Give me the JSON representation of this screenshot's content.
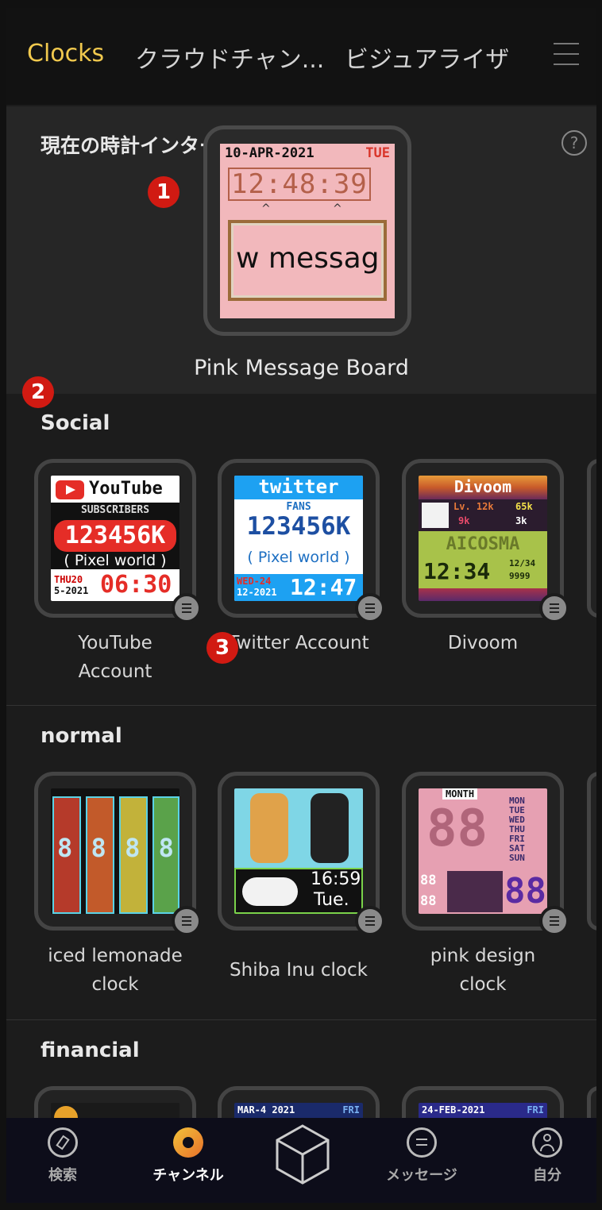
{
  "tabs": {
    "active": "Clocks",
    "cloud": "クラウドチャン...",
    "visualizer": "ビジュアライザ"
  },
  "icons": {
    "menu": "menu-icon",
    "help": "help-icon",
    "options": "list-options-icon",
    "search": "compass-icon",
    "channel": "gauge-icon",
    "cube": "cube-icon",
    "message": "chat-icon",
    "profile": "user-icon"
  },
  "current": {
    "label": "現在の時計インターフェイスです",
    "help": "?",
    "name": "Pink Message Board",
    "face": {
      "date": "10-APR-2021",
      "day": "TUE",
      "time": "12:48:39",
      "carets": "^",
      "message": "w messag"
    }
  },
  "badges": {
    "one": "1",
    "two": "2",
    "three": "3"
  },
  "sections": [
    {
      "title": "Social",
      "items": [
        {
          "name_lines": [
            "YouTube",
            "Account"
          ]
        },
        {
          "name_lines": [
            "Twitter Account"
          ]
        },
        {
          "name_lines": [
            "Divoom"
          ]
        }
      ]
    },
    {
      "title": "normal",
      "items": [
        {
          "name_lines": [
            "iced lemonade",
            "clock"
          ]
        },
        {
          "name_lines": [
            "Shiba Inu clock"
          ]
        },
        {
          "name_lines": [
            "pink design",
            "clock"
          ]
        }
      ]
    },
    {
      "title": "financial",
      "items": []
    }
  ],
  "faces": {
    "youtube": {
      "logo": "YouTube",
      "sub": "SUBSCRIBERS",
      "count": "123456K",
      "tag": "( Pixel world )",
      "date1": "THU20",
      "date2": "5-2021",
      "time": "06:30"
    },
    "twitter": {
      "logo": "twitter",
      "fans": "FANS",
      "count": "123456K",
      "tag": "( Pixel world )",
      "date1": "WED-24",
      "date2": "12-2021",
      "time": "12:47"
    },
    "divoom": {
      "logo": "Divoom",
      "lv": "Lv. 12k",
      "likes": "65k",
      "hearts": "9k",
      "other": "3k",
      "brand": "AICOSMA",
      "time": "12:34",
      "extra1": "12/34",
      "extra2": "9999"
    },
    "iced": {
      "digits": "8 8 8 8"
    },
    "shiba": {
      "time": "16:59",
      "day": "Tue."
    },
    "pink": {
      "month": "MONTH",
      "days": [
        "MON",
        "TUE",
        "WED",
        "THU",
        "FRI",
        "SAT",
        "SUN"
      ],
      "big": "88",
      "small": "88",
      "small2": "88"
    },
    "fin1": {
      "top": "MAR-4 2021",
      "day": "FRI"
    },
    "fin2": {
      "top": "24-FEB-2021",
      "day": "FRI"
    }
  },
  "bottom": {
    "search": "検索",
    "channel": "チャンネル",
    "message": "メッセージ",
    "profile": "自分"
  }
}
